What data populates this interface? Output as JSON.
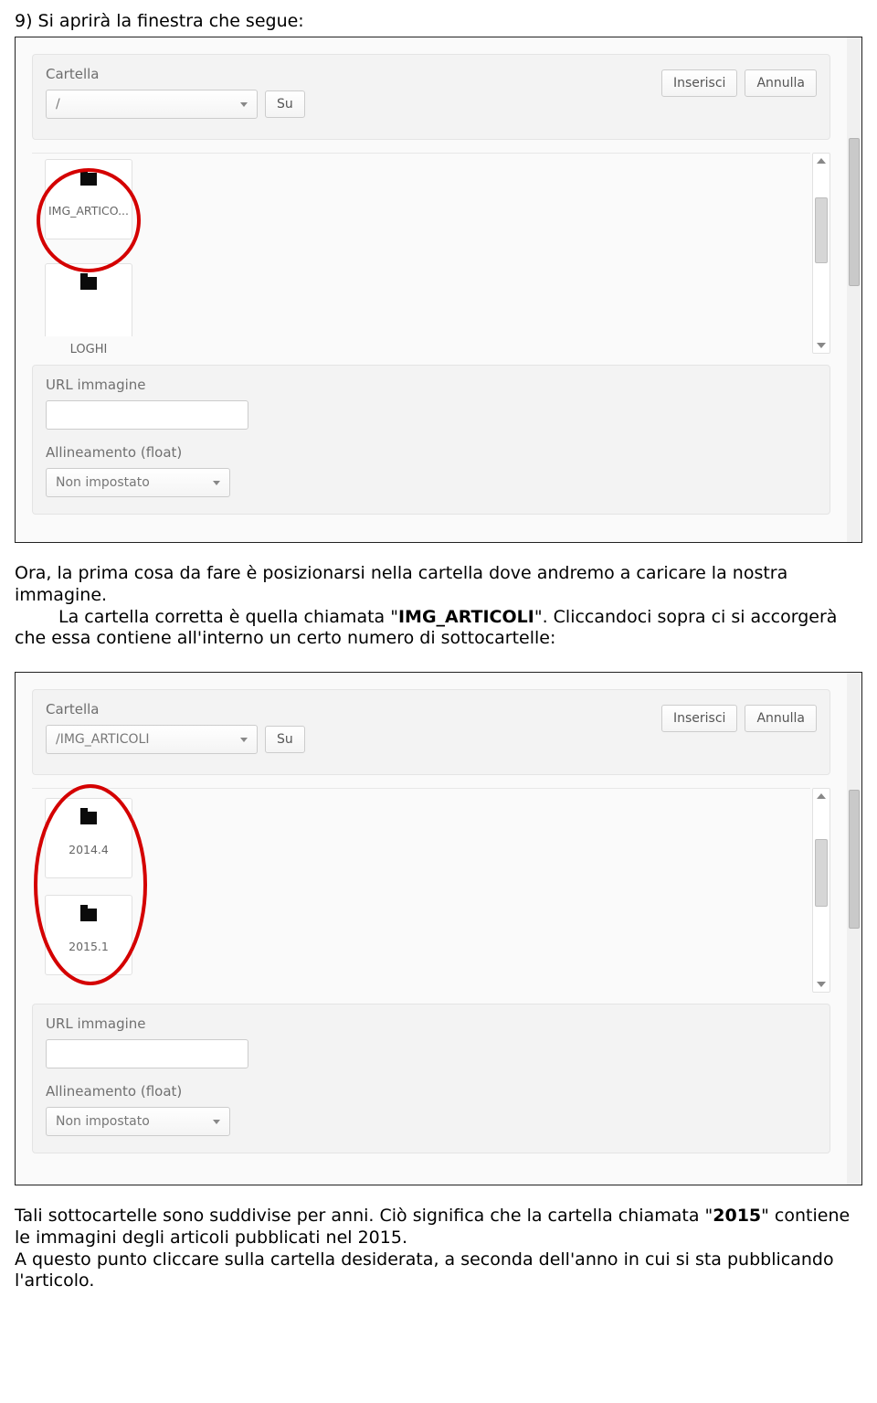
{
  "doc": {
    "step_heading": "9) Si aprirà la finestra che segue:",
    "para1_a": "Ora, la prima cosa da fare è posizionarsi nella cartella dove andremo a caricare la nostra immagine.",
    "para1_b_pre": "La cartella corretta è quella chiamata \"",
    "para1_b_bold": "IMG_ARTICOLI",
    "para1_b_post": "\". Cliccandoci sopra ci si accorgerà che essa contiene all'interno un certo numero di sottocartelle:",
    "para2_a_pre": "Tali sottocartelle sono suddivise per anni. Ciò significa che la cartella chiamata \"",
    "para2_a_bold": "2015",
    "para2_a_post": "\" contiene le immagini degli articoli pubblicati nel 2015.",
    "para2_b": "A questo punto cliccare sulla cartella desiderata, a seconda dell'anno in cui si sta pubblicando l'articolo."
  },
  "screenshot1": {
    "cartella_label": "Cartella",
    "path_value": "/",
    "su_label": "Su",
    "inserisci_label": "Inserisci",
    "annulla_label": "Annulla",
    "folder1": "IMG_ARTICO...",
    "folder2": "LOGHI",
    "url_label": "URL immagine",
    "align_label": "Allineamento (float)",
    "align_value": "Non impostato"
  },
  "screenshot2": {
    "cartella_label": "Cartella",
    "path_value": "/IMG_ARTICOLI",
    "su_label": "Su",
    "inserisci_label": "Inserisci",
    "annulla_label": "Annulla",
    "folder1": "2014.4",
    "folder2": "2015.1",
    "url_label": "URL immagine",
    "align_label": "Allineamento (float)",
    "align_value": "Non impostato"
  }
}
